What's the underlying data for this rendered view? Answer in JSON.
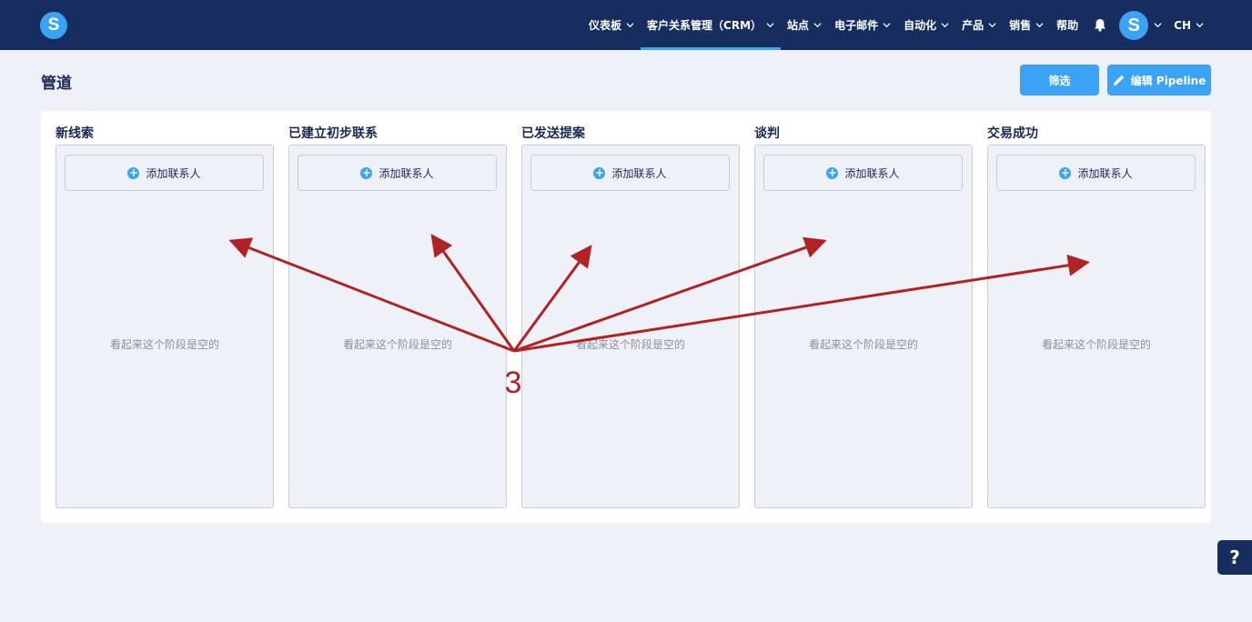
{
  "app": {
    "logo_letter": "S"
  },
  "nav": {
    "items": [
      {
        "label": "仪表板",
        "has_menu": true
      },
      {
        "label": "客户关系管理（CRM）",
        "has_menu": true,
        "active": true
      },
      {
        "label": "站点",
        "has_menu": true
      },
      {
        "label": "电子邮件",
        "has_menu": true
      },
      {
        "label": "自动化",
        "has_menu": true
      },
      {
        "label": "产品",
        "has_menu": true
      },
      {
        "label": "销售",
        "has_menu": true
      },
      {
        "label": "帮助",
        "has_menu": false
      }
    ],
    "avatar_letter": "S",
    "language": "CH",
    "accent": "#3aa3f5",
    "bar_color": "#172d5f"
  },
  "page": {
    "title": "管道",
    "filter_label": "筛选",
    "edit_label": "编辑 Pipeline"
  },
  "stages": [
    {
      "title": "新线索",
      "add_label": "添加联系人",
      "empty_text": "看起来这个阶段是空的"
    },
    {
      "title": "已建立初步联系",
      "add_label": "添加联系人",
      "empty_text": "看起来这个阶段是空的"
    },
    {
      "title": "已发送提案",
      "add_label": "添加联系人",
      "empty_text": "看起来这个阶段是空的"
    },
    {
      "title": "谈判",
      "add_label": "添加联系人",
      "empty_text": "看起来这个阶段是空的"
    },
    {
      "title": "交易成功",
      "add_label": "添加联系人",
      "empty_text": "看起来这个阶段是空的"
    }
  ],
  "annotation": {
    "label": "3",
    "color": "#b22222"
  },
  "help_button": {
    "label": "?"
  }
}
